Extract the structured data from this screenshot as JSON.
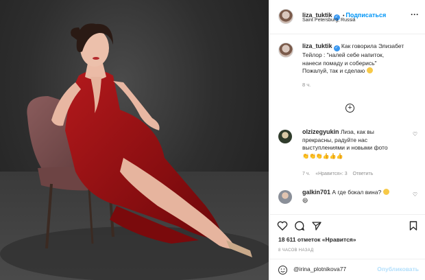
{
  "post": {
    "username": "liza_tuktik",
    "follow_label": "Подписаться",
    "location": "Saint Petersburg, Russia",
    "caption_lines": [
      "Как говорила Элизабет",
      "Тейлор : \"налей себе напиток,",
      "нанеси помаду и соберись\"",
      "Пожалуй, так и сделаю"
    ],
    "caption_time": "8 ч."
  },
  "comments": [
    {
      "username": "olzizegyukin",
      "lines": [
        "Лиза, как вы",
        "прекрасны, радуйте нас",
        "выступлениями и новыми фото"
      ],
      "emoji_line": "👏👏👏👍👍👍",
      "time": "7 ч.",
      "likes": "«Нравится»: 3",
      "reply": "Ответить"
    },
    {
      "username": "galkin701",
      "lines": [
        "А где бокал вина?"
      ],
      "emoji_line": "😄"
    }
  ],
  "stats": {
    "likes": "18 611 отметок «Нравится»",
    "ago": "8 ЧАСОВ НАЗАД"
  },
  "composer": {
    "value": "@irina_plotnikova77",
    "publish_label": "Опубликовать"
  },
  "icons": {
    "verified": "verified-badge-icon",
    "more": "more-horizontal-icon",
    "plus": "plus-circle-icon",
    "heart": "heart-icon",
    "comment": "comment-icon",
    "share": "share-icon",
    "save": "bookmark-icon",
    "emoji": "emoji-icon"
  },
  "colors": {
    "accent": "#0095f6",
    "publish_disabled": "#b2dffc",
    "dress": "#9b0f12"
  }
}
